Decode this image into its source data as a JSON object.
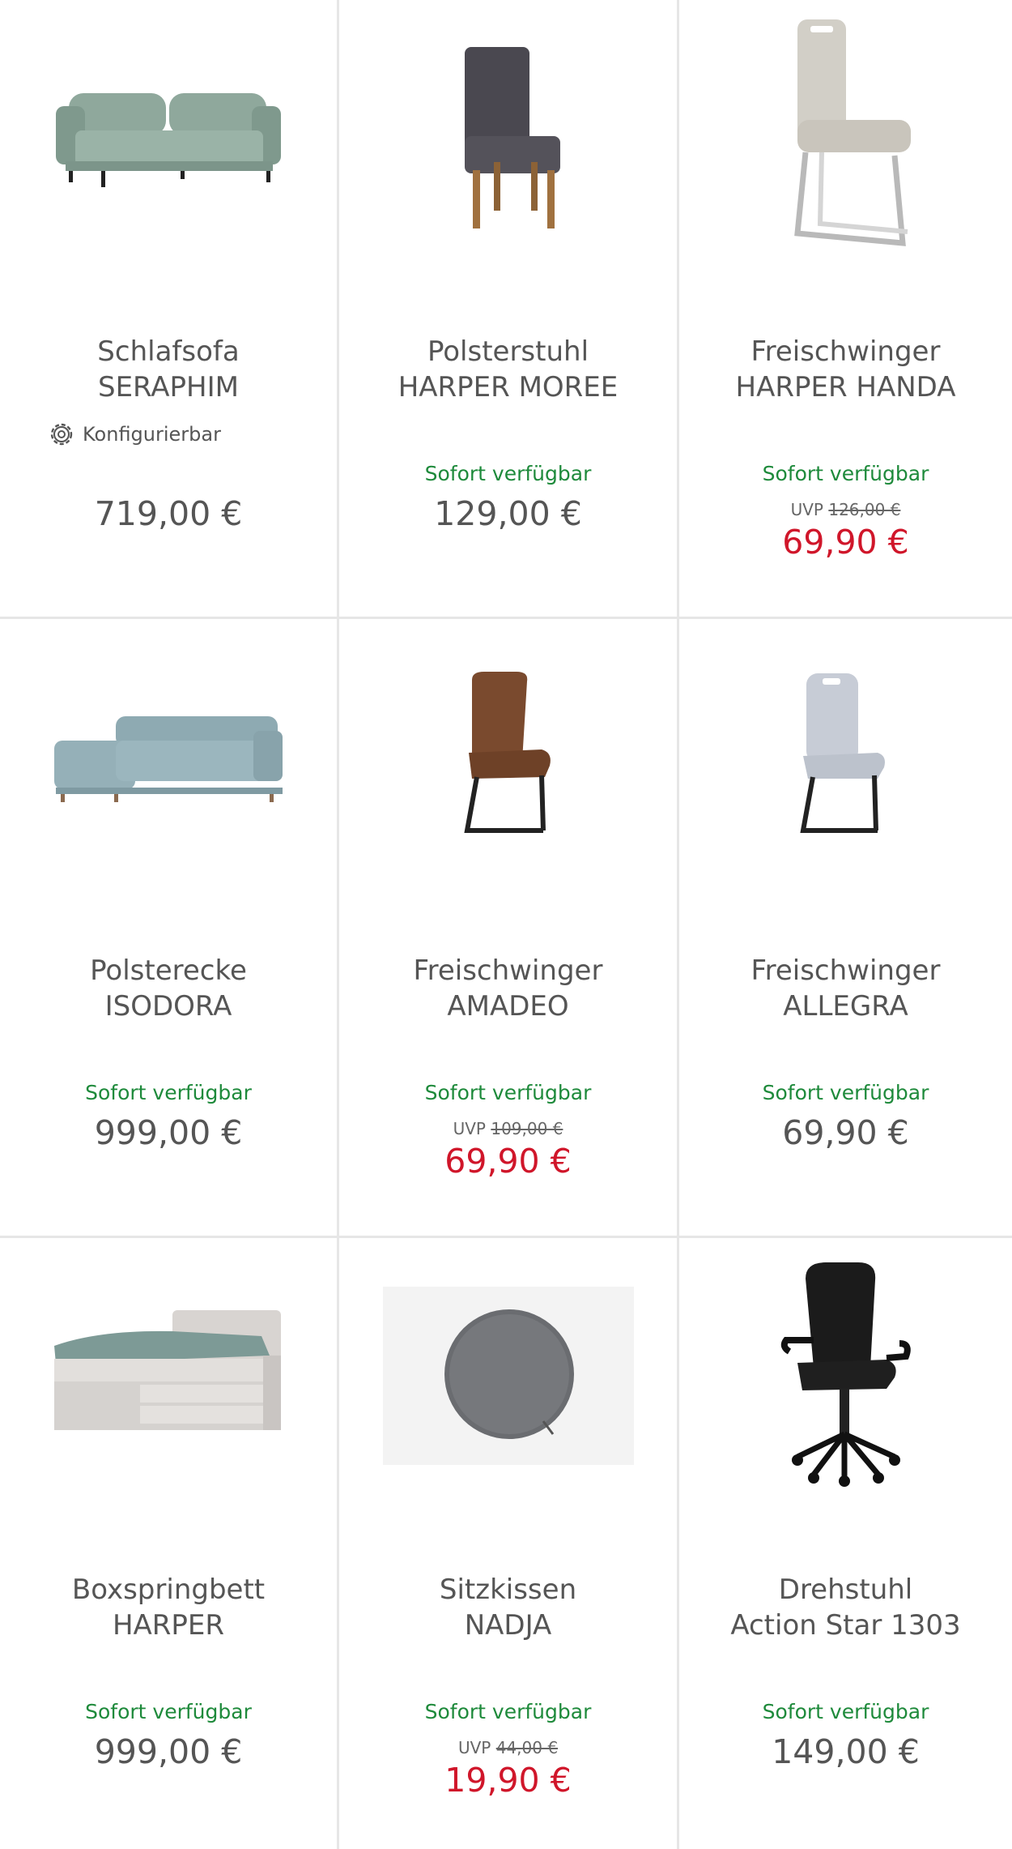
{
  "products": [
    {
      "title1": "Schlafsofa",
      "title2": "SERAPHIM",
      "config_label": "Konfigurierbar",
      "availability": "",
      "uvp_label": "",
      "uvp_price": "",
      "price": "719,00 €",
      "on_sale": false,
      "image": "sofa-image"
    },
    {
      "title1": "Polsterstuhl",
      "title2": "HARPER MOREE",
      "config_label": "",
      "availability": "Sofort verfügbar",
      "uvp_label": "",
      "uvp_price": "",
      "price": "129,00 €",
      "on_sale": false,
      "image": "chair-image"
    },
    {
      "title1": "Freischwinger",
      "title2": "HARPER HANDA",
      "config_label": "",
      "availability": "Sofort verfügbar",
      "uvp_label": "UVP",
      "uvp_price": "126,00 €",
      "price": "69,90 €",
      "on_sale": true,
      "image": "cantilever-chair-image"
    },
    {
      "title1": "Polsterecke",
      "title2": "ISODORA",
      "config_label": "",
      "availability": "Sofort verfügbar",
      "uvp_label": "",
      "uvp_price": "",
      "price": "999,00 €",
      "on_sale": false,
      "image": "corner-sofa-image"
    },
    {
      "title1": "Freischwinger",
      "title2": "AMADEO",
      "config_label": "",
      "availability": "Sofort verfügbar",
      "uvp_label": "UVP",
      "uvp_price": "109,00 €",
      "price": "69,90 €",
      "on_sale": true,
      "image": "brown-chair-image"
    },
    {
      "title1": "Freischwinger",
      "title2": "ALLEGRA",
      "config_label": "",
      "availability": "Sofort verfügbar",
      "uvp_label": "",
      "uvp_price": "",
      "price": "69,90 €",
      "on_sale": false,
      "image": "grey-chair-image"
    },
    {
      "title1": "Boxspringbett",
      "title2": "HARPER",
      "config_label": "",
      "availability": "Sofort verfügbar",
      "uvp_label": "",
      "uvp_price": "",
      "price": "999,00 €",
      "on_sale": false,
      "image": "bed-image"
    },
    {
      "title1": "Sitzkissen",
      "title2": "NADJA",
      "config_label": "",
      "availability": "Sofort verfügbar",
      "uvp_label": "UVP",
      "uvp_price": "44,00 €",
      "price": "19,90 €",
      "on_sale": true,
      "image": "cushion-image"
    },
    {
      "title1": "Drehstuhl",
      "title2": "Action Star 1303",
      "config_label": "",
      "availability": "Sofort verfügbar",
      "uvp_label": "",
      "uvp_price": "",
      "price": "149,00 €",
      "on_sale": false,
      "image": "office-chair-image"
    }
  ],
  "colors": {
    "availability": "#1e8a3b",
    "sale_price": "#d0162a",
    "text": "#555555",
    "divider": "#e6e6e6"
  }
}
